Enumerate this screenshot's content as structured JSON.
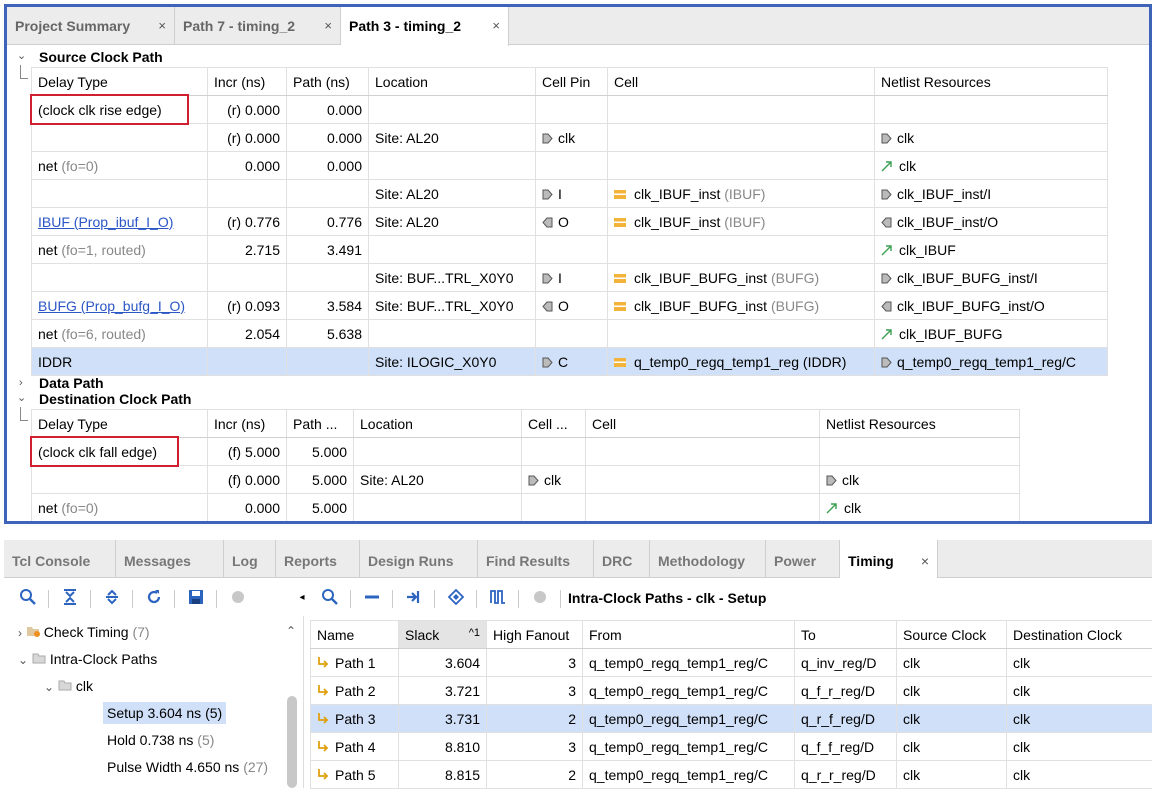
{
  "top_tabs": [
    {
      "label": "Project Summary",
      "close": "×"
    },
    {
      "label": "Path 7 - timing_2",
      "close": "×"
    },
    {
      "label": "Path 3 - timing_2",
      "close": "×"
    }
  ],
  "source_clock": {
    "title": "Source Clock Path",
    "headers": [
      "Delay Type",
      "Incr (ns)",
      "Path (ns)",
      "Location",
      "Cell Pin",
      "Cell",
      "Netlist Resources"
    ],
    "rows": [
      {
        "delay": "(clock clk rise edge)",
        "delay_note": "",
        "incr": "(r) 0.000",
        "path": "0.000",
        "location": "",
        "pin": "",
        "pin_dir": "",
        "cell": "",
        "cell_type": "",
        "netlist": "",
        "net_kind": ""
      },
      {
        "delay": "",
        "delay_note": "",
        "incr": "(r) 0.000",
        "path": "0.000",
        "location": "Site: AL20",
        "pin": "clk",
        "pin_dir": "in",
        "cell": "",
        "cell_type": "",
        "netlist": "clk",
        "net_kind": "port"
      },
      {
        "delay": "net",
        "delay_note": "(fo=0)",
        "incr": "0.000",
        "path": "0.000",
        "location": "",
        "pin": "",
        "pin_dir": "",
        "cell": "",
        "cell_type": "",
        "netlist": "clk",
        "net_kind": "net"
      },
      {
        "delay": "",
        "delay_note": "",
        "incr": "",
        "path": "",
        "location": "Site: AL20",
        "pin": "I",
        "pin_dir": "in",
        "cell": "clk_IBUF_inst",
        "cell_type": "(IBUF)",
        "netlist": "clk_IBUF_inst/I",
        "net_kind": "in"
      },
      {
        "delay": "IBUF (Prop_ibuf_I_O)",
        "delay_note": "",
        "link": true,
        "incr": "(r) 0.776",
        "path": "0.776",
        "location": "Site: AL20",
        "pin": "O",
        "pin_dir": "out",
        "cell": "clk_IBUF_inst",
        "cell_type": "(IBUF)",
        "netlist": "clk_IBUF_inst/O",
        "net_kind": "out"
      },
      {
        "delay": "net",
        "delay_note": "(fo=1, routed)",
        "incr": "2.715",
        "path": "3.491",
        "location": "",
        "pin": "",
        "pin_dir": "",
        "cell": "",
        "cell_type": "",
        "netlist": "clk_IBUF",
        "net_kind": "net"
      },
      {
        "delay": "",
        "delay_note": "",
        "incr": "",
        "path": "",
        "location": "Site: BUF...TRL_X0Y0",
        "pin": "I",
        "pin_dir": "in",
        "cell": "clk_IBUF_BUFG_inst",
        "cell_type": "(BUFG)",
        "netlist": "clk_IBUF_BUFG_inst/I",
        "net_kind": "in"
      },
      {
        "delay": "BUFG (Prop_bufg_I_O)",
        "delay_note": "",
        "link": true,
        "incr": "(r) 0.093",
        "path": "3.584",
        "location": "Site: BUF...TRL_X0Y0",
        "pin": "O",
        "pin_dir": "out",
        "cell": "clk_IBUF_BUFG_inst",
        "cell_type": "(BUFG)",
        "netlist": "clk_IBUF_BUFG_inst/O",
        "net_kind": "out"
      },
      {
        "delay": "net",
        "delay_note": "(fo=6, routed)",
        "incr": "2.054",
        "path": "5.638",
        "location": "",
        "pin": "",
        "pin_dir": "",
        "cell": "",
        "cell_type": "",
        "netlist": "clk_IBUF_BUFG",
        "net_kind": "net"
      },
      {
        "delay": "IDDR",
        "delay_note": "",
        "incr": "",
        "path": "",
        "location": "Site: ILOGIC_X0Y0",
        "pin": "C",
        "pin_dir": "in",
        "cell": "q_temp0_regq_temp1_reg",
        "cell_type": "(IDDR)",
        "netlist": "q_temp0_regq_temp1_reg/C",
        "net_kind": "in",
        "selected": true
      }
    ]
  },
  "data_path": {
    "title": "Data Path"
  },
  "dest_clock": {
    "title": "Destination Clock Path",
    "headers": [
      "Delay Type",
      "Incr (ns)",
      "Path ...",
      "Location",
      "Cell ...",
      "Cell",
      "Netlist Resources"
    ],
    "rows": [
      {
        "delay": "(clock clk fall edge)",
        "delay_note": "",
        "incr": "(f) 5.000",
        "path": "5.000",
        "location": "",
        "pin": "",
        "pin_dir": "",
        "cell": "",
        "netlist": "",
        "net_kind": ""
      },
      {
        "delay": "",
        "delay_note": "",
        "incr": "(f) 0.000",
        "path": "5.000",
        "location": "Site: AL20",
        "pin": "clk",
        "pin_dir": "in",
        "cell": "",
        "netlist": "clk",
        "net_kind": "port"
      },
      {
        "delay": "net",
        "delay_note": "(fo=0)",
        "incr": "0.000",
        "path": "5.000",
        "location": "",
        "pin": "",
        "pin_dir": "",
        "cell": "",
        "netlist": "clk",
        "net_kind": "net"
      }
    ]
  },
  "bottom_tabs": [
    "Tcl Console",
    "Messages",
    "Log",
    "Reports",
    "Design Runs",
    "Find Results",
    "DRC",
    "Methodology",
    "Power",
    "Timing"
  ],
  "bottom_active_close": "×",
  "right_toolbar_title": "Intra-Clock Paths - clk - Setup",
  "tree": {
    "check_timing": {
      "label": "Check Timing",
      "count": "(7)"
    },
    "intra_clock": {
      "label": "Intra-Clock Paths"
    },
    "clk": {
      "label": "clk"
    },
    "setup": {
      "label": "Setup 3.604 ns",
      "count": "(5)"
    },
    "hold": {
      "label": "Hold 0.738 ns",
      "count": "(5)"
    },
    "pulse": {
      "label": "Pulse Width 4.650 ns",
      "count": "(27)"
    }
  },
  "paths_table": {
    "headers": [
      "Name",
      "Slack",
      "High Fanout",
      "From",
      "To",
      "Source Clock",
      "Destination Clock"
    ],
    "sort_indicator": "^1",
    "rows": [
      {
        "name": "Path 1",
        "slack": "3.604",
        "fanout": "3",
        "from": "q_temp0_regq_temp1_reg/C",
        "to": "q_inv_reg/D",
        "src": "clk",
        "dst": "clk"
      },
      {
        "name": "Path 2",
        "slack": "3.721",
        "fanout": "3",
        "from": "q_temp0_regq_temp1_reg/C",
        "to": "q_f_r_reg/D",
        "src": "clk",
        "dst": "clk"
      },
      {
        "name": "Path 3",
        "slack": "3.731",
        "fanout": "2",
        "from": "q_temp0_regq_temp1_reg/C",
        "to": "q_r_f_reg/D",
        "src": "clk",
        "dst": "clk",
        "selected": true
      },
      {
        "name": "Path 4",
        "slack": "8.810",
        "fanout": "3",
        "from": "q_temp0_regq_temp1_reg/C",
        "to": "q_f_f_reg/D",
        "src": "clk",
        "dst": "clk"
      },
      {
        "name": "Path 5",
        "slack": "8.815",
        "fanout": "2",
        "from": "q_temp0_regq_temp1_reg/C",
        "to": "q_r_r_reg/D",
        "src": "clk",
        "dst": "clk"
      }
    ]
  },
  "colors": {
    "accent": "#3f63b8",
    "selection": "#cfe0f8",
    "highlight_box": "#d02030",
    "cell_icon": "#f2b43a",
    "net_icon": "#3aa050",
    "link": "#2a56c6"
  }
}
